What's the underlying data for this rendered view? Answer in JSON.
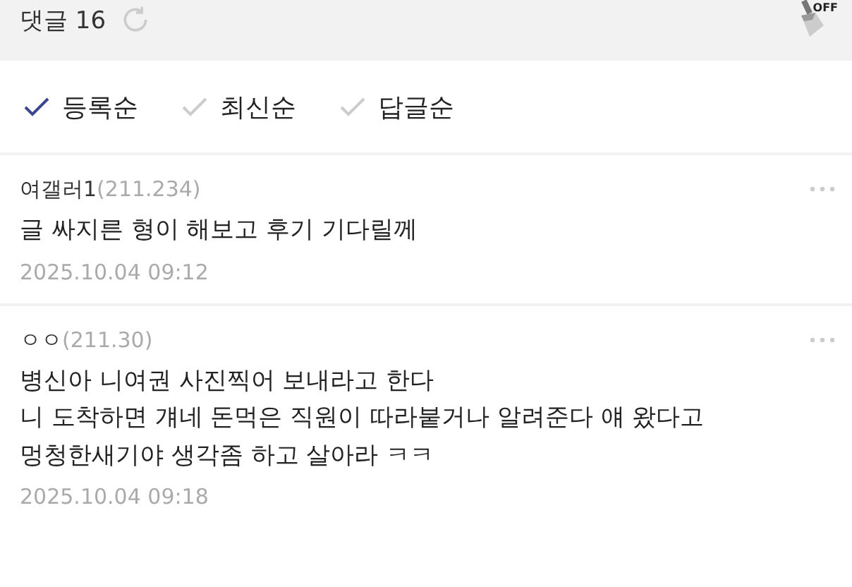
{
  "header": {
    "title": "댓글 16",
    "broom_badge": "OFF"
  },
  "sort_options": [
    {
      "label": "등록순",
      "selected": true
    },
    {
      "label": "최신순",
      "selected": false
    },
    {
      "label": "답글순",
      "selected": false
    }
  ],
  "comments": [
    {
      "author": "여갤러1",
      "ip": "(211.234)",
      "body": "글 싸지른 형이 해보고 후기 기다릴께",
      "date": "2025.10.04 09:12"
    },
    {
      "author": "ㅇㅇ",
      "ip": "(211.30)",
      "body": "병신아 니여권 사진찍어 보내라고 한다\n니 도착하면 걔네 돈먹은 직원이 따라붙거나 알려준다 얘 왔다고\n멍청한새기야 생각좀 하고 살아라 ㅋㅋ",
      "date": "2025.10.04 09:18"
    }
  ]
}
